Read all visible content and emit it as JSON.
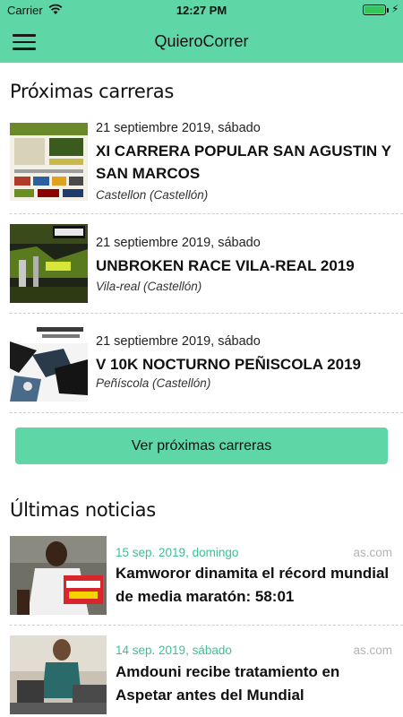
{
  "status_bar": {
    "carrier": "Carrier",
    "time": "12:27 PM"
  },
  "nav": {
    "title": "QuieroCorrer",
    "menu_icon": "hamburger-menu-icon"
  },
  "upcoming": {
    "title": "Próximas carreras",
    "races": [
      {
        "date": "21 septiembre 2019, sábado",
        "name": "XI CARRERA POPULAR SAN AGUSTIN Y SAN MARCOS",
        "location": "Castellon (Castellón)"
      },
      {
        "date": "21 septiembre 2019, sábado",
        "name": "UNBROKEN RACE VILA-REAL 2019",
        "location": "Vila-real (Castellón)"
      },
      {
        "date": "21 septiembre 2019, sábado",
        "name": "V 10K NOCTURNO PEÑISCOLA 2019",
        "location": "Peñíscola (Castellón)"
      }
    ],
    "cta_label": "Ver próximas carreras"
  },
  "news": {
    "title": "Últimas noticias",
    "items": [
      {
        "date": "15 sep. 2019, domingo",
        "source": "as.com",
        "title": "Kamworor dinamita el récord mundial de media maratón: 58:01"
      },
      {
        "date": "14 sep. 2019, sábado",
        "source": "as.com",
        "title": "Amdouni recibe tratamiento en Aspetar antes del Mundial"
      }
    ]
  },
  "colors": {
    "accent": "#5fd6a6",
    "news_date": "#3cc291",
    "source": "#b4b4b4"
  }
}
